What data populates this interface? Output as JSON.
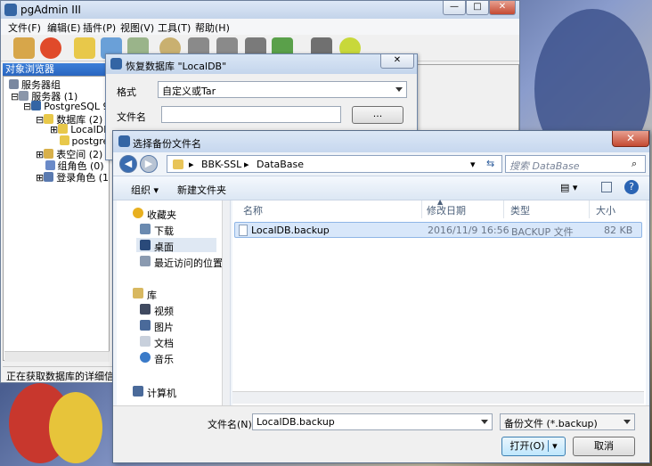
{
  "pgadmin": {
    "title": "pgAdmin III",
    "menu": [
      "文件(F)",
      "编辑(E)",
      "插件(P)",
      "视图(V)",
      "工具(T)",
      "帮助(H)"
    ],
    "browser_header": "对象浏览器",
    "tree": {
      "server_groups": "服务器组",
      "servers": "服务器 (1)",
      "postgres": "PostgreSQL 9.",
      "databases": "数据库 (2)",
      "db1": "LocalDB",
      "db2": "postgre",
      "tablespaces": "表空间 (2)",
      "group_roles": "组角色 (0)",
      "login_roles": "登录角色 (1"
    },
    "status": "正在获取数据库的详细信息"
  },
  "restore": {
    "title": "恢复数据库 \"LocalDB\"",
    "format_label": "格式",
    "format_value": "自定义或Tar",
    "filename_label": "文件名",
    "browse_label": "..."
  },
  "file_dialog": {
    "title": "选择备份文件名",
    "close": "✕",
    "path": [
      "BBK-SSL",
      "DataBase"
    ],
    "search_placeholder": "搜索 DataBase",
    "organize": "组织 ▾",
    "new_folder": "新建文件夹",
    "nav": {
      "favorites": "收藏夹",
      "downloads": "下载",
      "desktop": "桌面",
      "recent": "最近访问的位置",
      "libraries": "库",
      "videos": "视频",
      "pictures": "图片",
      "documents": "文档",
      "music": "音乐",
      "computer": "计算机"
    },
    "columns": {
      "name": "名称",
      "date": "修改日期",
      "type": "类型",
      "size": "大小"
    },
    "file": {
      "name": "LocalDB.backup",
      "date": "2016/11/9 16:56",
      "type": "BACKUP 文件",
      "size": "82 KB"
    },
    "filename_label": "文件名(N):",
    "filename_value": "LocalDB.backup",
    "filter_value": "备份文件 (*.backup)",
    "open_label": "打开(O)",
    "cancel_label": "取消"
  }
}
